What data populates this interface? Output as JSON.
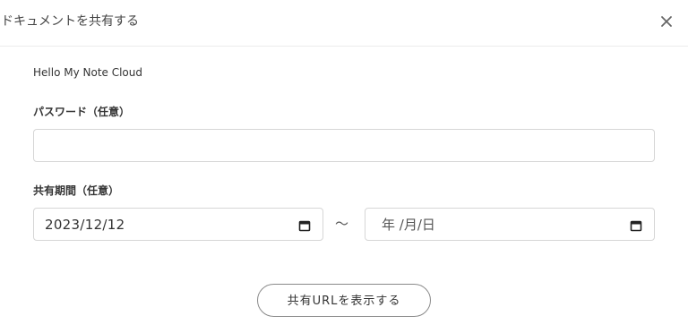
{
  "modal": {
    "title": "ドキュメントを共有する",
    "close_icon": "close-icon"
  },
  "document": {
    "name": "Hello My Note Cloud"
  },
  "password": {
    "label": "パスワード（任意）",
    "value": "",
    "placeholder": ""
  },
  "period": {
    "label": "共有期間（任意）",
    "start_value": "2023/12/12",
    "separator": "～",
    "end_placeholder": "年 /月/日",
    "calendar_icon": "calendar-icon"
  },
  "actions": {
    "show_url_label": "共有URLを表示する"
  },
  "colors": {
    "border": "#d6d6d6",
    "text": "#333333",
    "button_border": "#8a8a8a"
  }
}
